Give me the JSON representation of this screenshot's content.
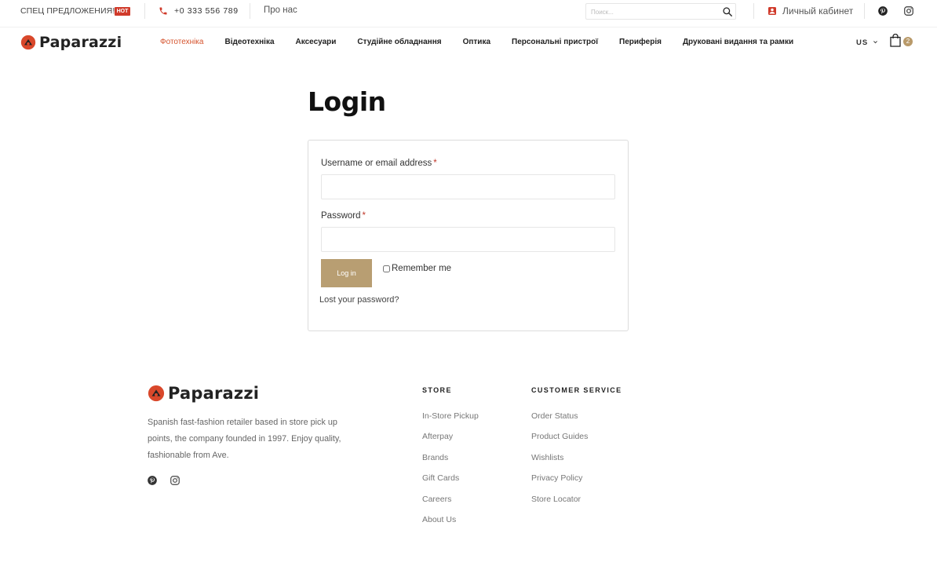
{
  "topbar": {
    "promo": "СПЕЦ ПРЕДЛОЖЕНИЯ!",
    "hot_badge": "HOT",
    "phone": "+0 333 556 789",
    "about": "Про нас",
    "search_placeholder": "Поиск...",
    "account": "Личный кабинет",
    "icons": [
      "phone-icon",
      "search-icon",
      "account-icon",
      "pinterest-icon",
      "instagram-icon"
    ]
  },
  "nav": {
    "logo": "Paparazzi",
    "items": [
      "Фототехніка",
      "Відеотехніка",
      "Аксесуари",
      "Студійне обладнання",
      "Оптика",
      "Персональні пристрої",
      "Периферія",
      "Друковані видання та рамки"
    ],
    "active_index": 0,
    "currency": "US",
    "cart_count": "2",
    "icons": [
      "chevron-down-icon",
      "cart-icon"
    ]
  },
  "login": {
    "title": "Login",
    "username_label": "Username or email address",
    "password_label": "Password",
    "required_mark": "*",
    "username_value": "",
    "password_value": "",
    "button": "Log in",
    "remember": "Remember me",
    "remember_checked": false,
    "lost_password": "Lost your password?"
  },
  "footer": {
    "logo": "Paparazzi",
    "description": "Spanish fast-fashion retailer based in store pick up points, the company founded in 1997. Enjoy quality, fashionable from Ave.",
    "store_heading": "STORE",
    "store_links": [
      "In-Store Pickup",
      "Afterpay",
      "Brands",
      "Gift Cards",
      "Careers",
      "About Us"
    ],
    "service_heading": "CUSTOMER SERVICE",
    "service_links": [
      "Order Status",
      "Product Guides",
      "Wishlists",
      "Privacy Policy",
      "Store Locator"
    ],
    "icons": [
      "pinterest-icon",
      "instagram-icon"
    ]
  },
  "colors": {
    "accent": "#d5532d",
    "hot_badge": "#d03a2a",
    "button": "#b89e72",
    "cart_badge": "#b99a6a",
    "logo_mark": "#d9482b"
  }
}
